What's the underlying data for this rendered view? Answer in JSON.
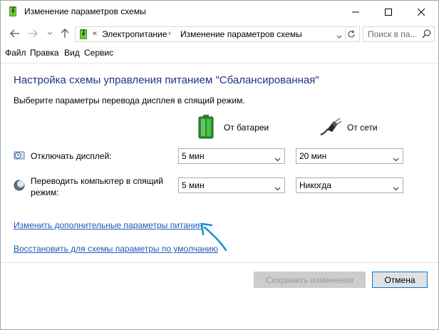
{
  "window": {
    "title": "Изменение параметров схемы"
  },
  "address": {
    "separator": "«",
    "crumbs": [
      "Электропитание",
      "Изменение параметров схемы"
    ],
    "search_placeholder": "Поиск в па..."
  },
  "menu": {
    "items": [
      {
        "label": "Файл"
      },
      {
        "label": "Правка"
      },
      {
        "label": "Вид"
      },
      {
        "label": "Сервис"
      }
    ]
  },
  "main": {
    "title": "Настройка схемы управления питанием \"Сбалансированная\"",
    "subtitle": "Выберите параметры перевода дисплея в спящий режим.",
    "columns": {
      "battery": "От батареи",
      "plugged": "От сети"
    },
    "rows": [
      {
        "label": "Отключать дисплей:",
        "battery_value": "5 мин",
        "plugged_value": "20 мин"
      },
      {
        "label_line1": "Переводить компьютер в спящий",
        "label_line2": "режим:",
        "battery_value": "5 мин",
        "plugged_value": "Никогда"
      }
    ],
    "links": {
      "advanced": "Изменить дополнительные параметры питания",
      "restore": "Восстановить для схемы параметры по умолчанию"
    }
  },
  "footer": {
    "save_label": "Сохранить изменения",
    "cancel_label": "Отмена"
  },
  "colors": {
    "title_blue": "#1e3287",
    "link_blue": "#1d5bb3",
    "arrow_blue": "#1e8fd0",
    "battery_green": "#3cb83c"
  }
}
